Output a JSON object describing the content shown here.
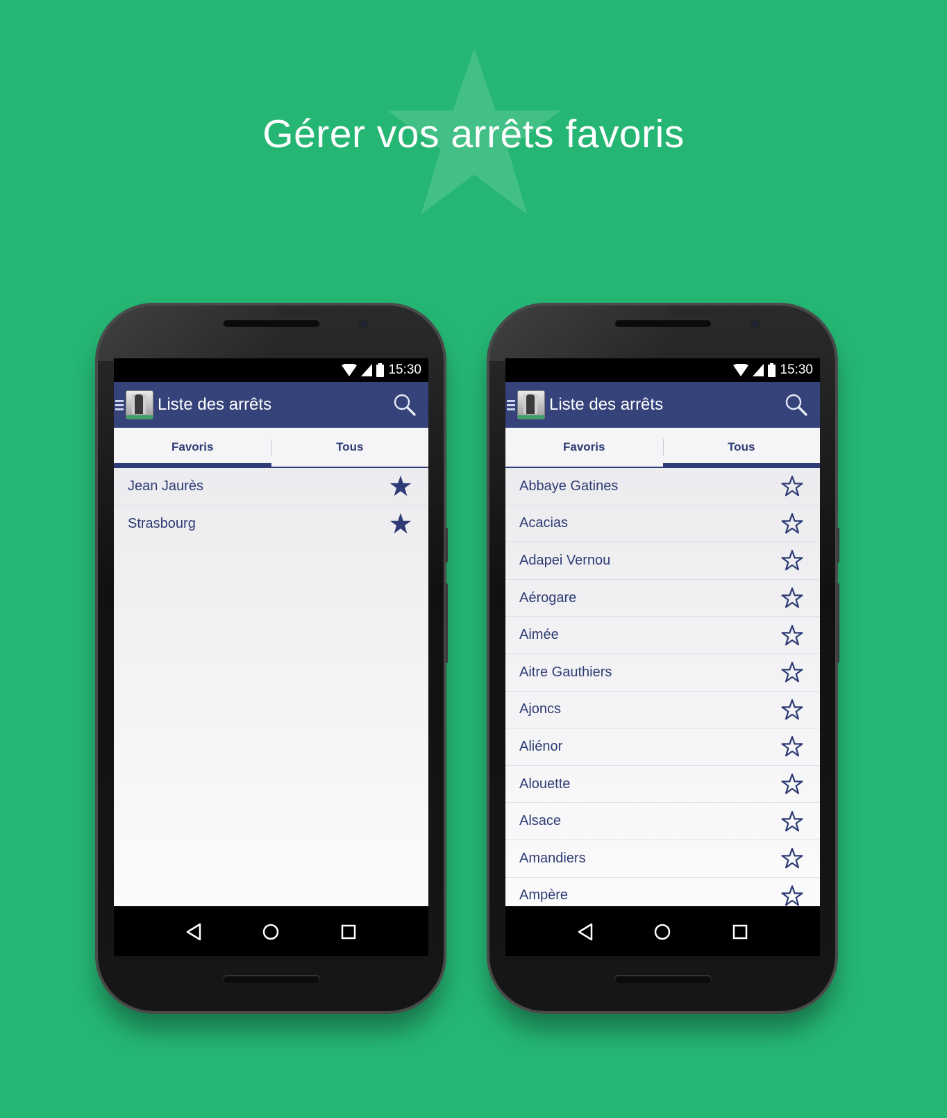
{
  "headline": "Gérer vos arrêts favoris",
  "colors": {
    "background": "#25b673",
    "appbar": "#35437a",
    "accent": "#2e3b74"
  },
  "phones": [
    {
      "status_time": "15:30",
      "app_title": "Liste des arrêts",
      "tabs": [
        {
          "label": "Favoris",
          "active": true
        },
        {
          "label": "Tous",
          "active": false
        }
      ],
      "stops": [
        {
          "name": "Jean Jaurès",
          "icon": "star-filled-icon"
        },
        {
          "name": "Strasbourg",
          "icon": "star-filled-icon"
        }
      ]
    },
    {
      "status_time": "15:30",
      "app_title": "Liste des arrêts",
      "tabs": [
        {
          "label": "Favoris",
          "active": false
        },
        {
          "label": "Tous",
          "active": true
        }
      ],
      "stops": [
        {
          "name": "Abbaye Gatines",
          "icon": "star-outline-icon"
        },
        {
          "name": "Acacias",
          "icon": "star-outline-icon"
        },
        {
          "name": "Adapei Vernou",
          "icon": "star-outline-icon"
        },
        {
          "name": "Aérogare",
          "icon": "star-outline-icon"
        },
        {
          "name": "Aimée",
          "icon": "star-outline-icon"
        },
        {
          "name": "Aitre Gauthiers",
          "icon": "star-outline-icon"
        },
        {
          "name": "Ajoncs",
          "icon": "star-outline-icon"
        },
        {
          "name": "Aliénor",
          "icon": "star-outline-icon"
        },
        {
          "name": "Alouette",
          "icon": "star-outline-icon"
        },
        {
          "name": "Alsace",
          "icon": "star-outline-icon"
        },
        {
          "name": "Amandiers",
          "icon": "star-outline-icon"
        },
        {
          "name": "Ampère",
          "icon": "star-outline-icon"
        }
      ]
    }
  ]
}
